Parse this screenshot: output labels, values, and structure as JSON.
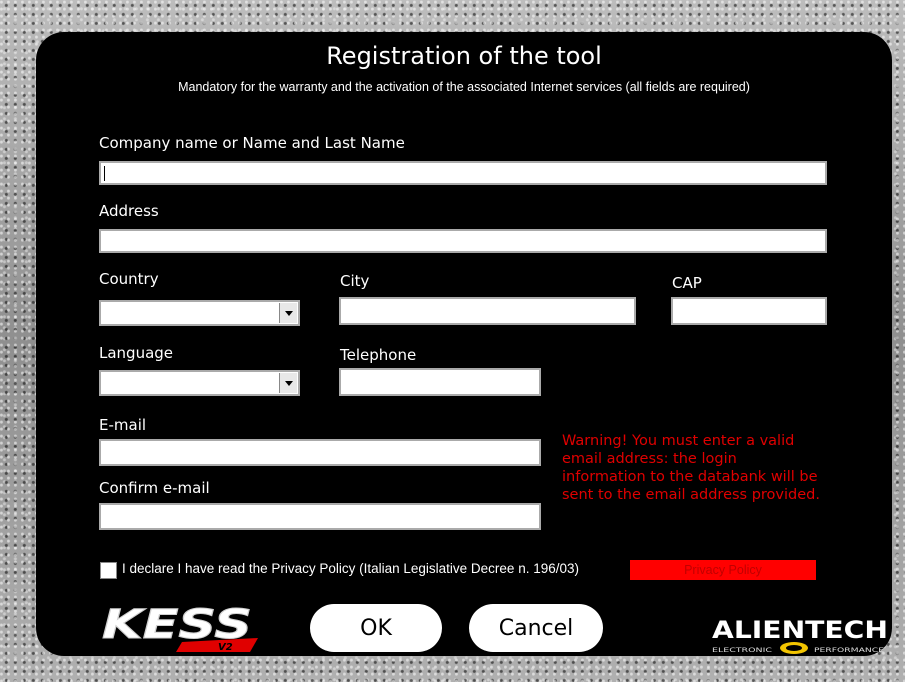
{
  "dialog": {
    "title": "Registration of the tool",
    "subtitle": "Mandatory for the warranty and the activation of the associated Internet services (all fields are required)"
  },
  "form": {
    "company_label": "Company name or Name and Last Name",
    "company_value": "",
    "address_label": "Address",
    "address_value": "",
    "country_label": "Country",
    "country_value": "",
    "city_label": "City",
    "city_value": "",
    "cap_label": "CAP",
    "cap_value": "",
    "language_label": "Language",
    "language_value": "",
    "telephone_label": "Telephone",
    "telephone_value": "",
    "email_label": "E-mail",
    "email_value": "",
    "confirm_email_label": "Confirm e-mail",
    "confirm_email_value": ""
  },
  "warning": "Warning! You must enter a valid email address: the login information to the databank will be sent to the email address provided.",
  "privacy": {
    "checkbox_label": "I declare I have read the Privacy Policy (Italian Legislative Decree n. 196/03)",
    "checked": false,
    "button_label": "Privacy Policy"
  },
  "buttons": {
    "ok_label": "OK",
    "cancel_label": "Cancel"
  },
  "logos": {
    "kess_text": "KESS",
    "kess_version": "V2",
    "alientech_text": "ALIENTECH",
    "alientech_tagline_left": "ELECTRONIC",
    "alientech_tagline_right": "PERFORMANCE"
  },
  "colors": {
    "panel": "#000000",
    "warning": "#e00000",
    "privacy_button": "#ff0000",
    "brand_red": "#e00000",
    "alientech_yellow": "#f2c400"
  }
}
